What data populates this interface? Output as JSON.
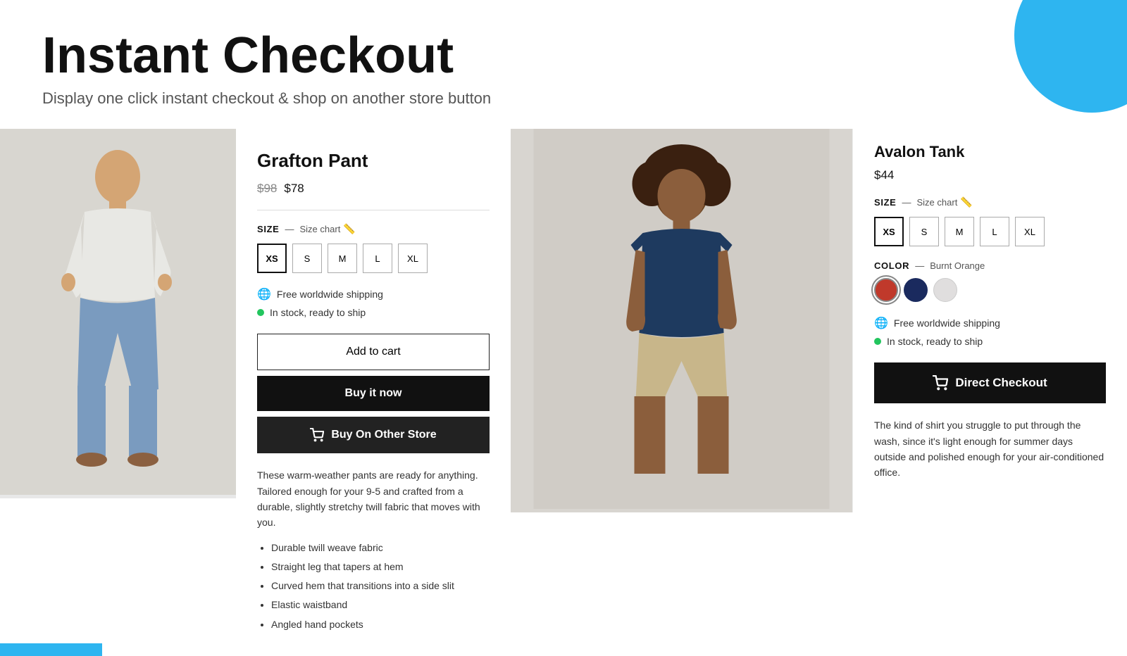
{
  "header": {
    "title": "Instant Checkout",
    "subtitle": "Display one click instant checkout & shop on another store button"
  },
  "product_left": {
    "name": "Grafton Pant",
    "price_original": "$98",
    "price_sale": "$78",
    "size_label": "SIZE",
    "size_chart_text": "Size chart",
    "sizes": [
      "XS",
      "S",
      "M",
      "L",
      "XL"
    ],
    "selected_size": "XS",
    "shipping_text": "Free worldwide shipping",
    "stock_text": "In stock, ready to ship",
    "btn_add_cart": "Add to cart",
    "btn_buy_now": "Buy it now",
    "btn_other_store": "Buy On Other Store",
    "description": "These warm-weather pants are ready for anything. Tailored enough for your 9-5 and crafted from a durable, slightly stretchy twill fabric that moves with you.",
    "features": [
      "Durable twill weave fabric",
      "Straight leg that tapers at hem",
      "Curved hem that transitions into a side slit",
      "Elastic waistband",
      "Angled hand pockets"
    ]
  },
  "product_right": {
    "name": "Avalon Tank",
    "price": "$44",
    "size_label": "SIZE",
    "size_chart_text": "Size chart",
    "sizes": [
      "XS",
      "S",
      "M",
      "L",
      "XL"
    ],
    "selected_size": "XS",
    "color_label": "COLOR",
    "color_value": "Burnt Orange",
    "colors": [
      {
        "name": "burnt-orange",
        "hex": "#c0392b"
      },
      {
        "name": "navy",
        "hex": "#1a2a5e"
      },
      {
        "name": "light-gray",
        "hex": "#e0dede"
      }
    ],
    "selected_color": "burnt-orange",
    "shipping_text": "Free worldwide shipping",
    "stock_text": "In stock, ready to ship",
    "btn_direct_checkout": "Direct Checkout",
    "description": "The kind of shirt you struggle to put through the wash, since it's light enough for summer days outside and polished enough for your air-conditioned office."
  },
  "icons": {
    "globe": "🌐",
    "cart": "🛒"
  }
}
